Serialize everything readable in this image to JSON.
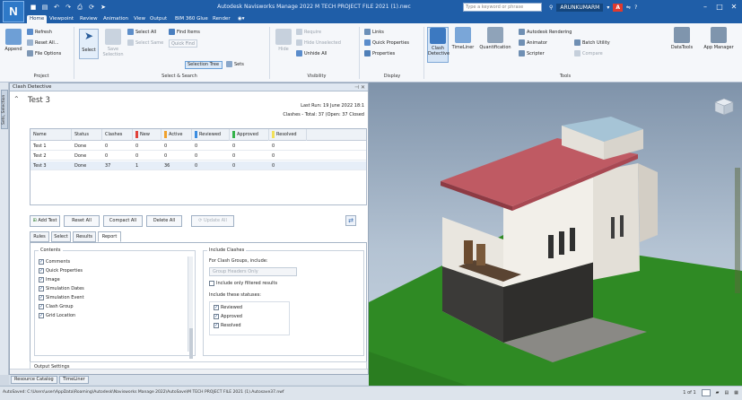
{
  "app": {
    "logo": "N",
    "title": "Autodesk Navisworks Manage 2022   M TECH PROJECT FILE 2021 (1).nwc",
    "search_placeholder": "Type a keyword or phrase",
    "username": "ARUNKUMARM",
    "badge": "A"
  },
  "menu": {
    "tabs": [
      "Home",
      "Viewpoint",
      "Review",
      "Animation",
      "View",
      "Output",
      "BIM 360 Glue",
      "Render"
    ]
  },
  "ribbon": {
    "project": {
      "append": "Append",
      "refresh": "Refresh",
      "reset_all": "Reset All...",
      "file_options": "File Options",
      "group": "Project"
    },
    "select_search": {
      "select": "Select",
      "save_selection": "Save Selection",
      "select_all": "Select All",
      "select_same": "Select Same",
      "selection_tree": "Selection Tree",
      "find_items": "Find Items",
      "quick_find": "Quick Find",
      "sets": "Sets",
      "group": "Select & Search"
    },
    "visibility": {
      "hide": "Hide",
      "require": "Require",
      "hide_unselected": "Hide Unselected",
      "unhide_all": "Unhide All",
      "group": "Visibility"
    },
    "display": {
      "links": "Links",
      "quick_properties": "Quick Properties",
      "properties": "Properties",
      "group": "Display"
    },
    "tools": {
      "clash_detective": "Clash Detective",
      "timeliner": "TimeLiner",
      "quantification": "Quantification",
      "autodesk_rendering": "Autodesk Rendering",
      "animator": "Animator",
      "scripter": "Scripter",
      "batch_utility": "Batch Utility",
      "compare": "Compare",
      "datatools": "DataTools",
      "app_manager": "App Manager",
      "group": "Tools"
    }
  },
  "side_strip": {
    "label": "Sets, Selection"
  },
  "panel": {
    "title": "Clash Detective",
    "test_name": "Test 3",
    "last_run": "Last Run:  19 June 2022 18:1",
    "totals": "Clashes - Total:  37  (Open:  37  Closed"
  },
  "table": {
    "headers": [
      "Name",
      "Status",
      "Clashes",
      "New",
      "Active",
      "Reviewed",
      "Approved",
      "Resolved"
    ],
    "header_colors": [
      "",
      "",
      "",
      "#e0423a",
      "#f0a12c",
      "#3c8de0",
      "#35b24a",
      "#f2e15a"
    ],
    "rows": [
      [
        "Test 1",
        "Done",
        "0",
        "0",
        "0",
        "0",
        "0",
        "0"
      ],
      [
        "Test 2",
        "Done",
        "0",
        "0",
        "0",
        "0",
        "0",
        "0"
      ],
      [
        "Test 3",
        "Done",
        "37",
        "1",
        "36",
        "0",
        "0",
        "0"
      ]
    ]
  },
  "buttons": {
    "add_test": "Add Test",
    "reset_all": "Reset All",
    "compact_all": "Compact All",
    "delete_all": "Delete All",
    "update_all": "Update All"
  },
  "tabs": [
    "Rules",
    "Select",
    "Results",
    "Report"
  ],
  "report": {
    "contents_legend": "Contents",
    "contents_items": [
      {
        "label": "Comments",
        "checked": true
      },
      {
        "label": "Quick Properties",
        "checked": true
      },
      {
        "label": "Image",
        "checked": true
      },
      {
        "label": "Simulation Dates",
        "checked": true
      },
      {
        "label": "Simulation Event",
        "checked": true
      },
      {
        "label": "Clash Group",
        "checked": true
      },
      {
        "label": "Grid Location",
        "checked": true
      }
    ],
    "include_legend": "Include Clashes",
    "for_groups_label": "For Clash Groups, include:",
    "group_select": "Group Headers Only",
    "only_filtered": "Include only filtered results",
    "statuses_label": "Include these statuses:",
    "statuses": [
      {
        "label": "Reviewed",
        "checked": true
      },
      {
        "label": "Approved",
        "checked": true
      },
      {
        "label": "Resolved",
        "checked": true
      }
    ],
    "output_settings": "Output Settings"
  },
  "bottom_tabs": [
    "Resource Catalog",
    "TimeLiner"
  ],
  "status": {
    "path": "AutoSaved: C:\\Users\\user\\AppData\\Roaming\\Autodesk\\Navisworks Manage 2022\\AutoSave\\M TECH PROJECT FILE 2021 (1).Autosave37.nwf",
    "page": "1 of 1"
  },
  "colors": {
    "titlebar": "#1f5ea8",
    "sky_top": "#8fa3b8",
    "grass": "#2f8a24",
    "roof": "#bf5a63"
  }
}
